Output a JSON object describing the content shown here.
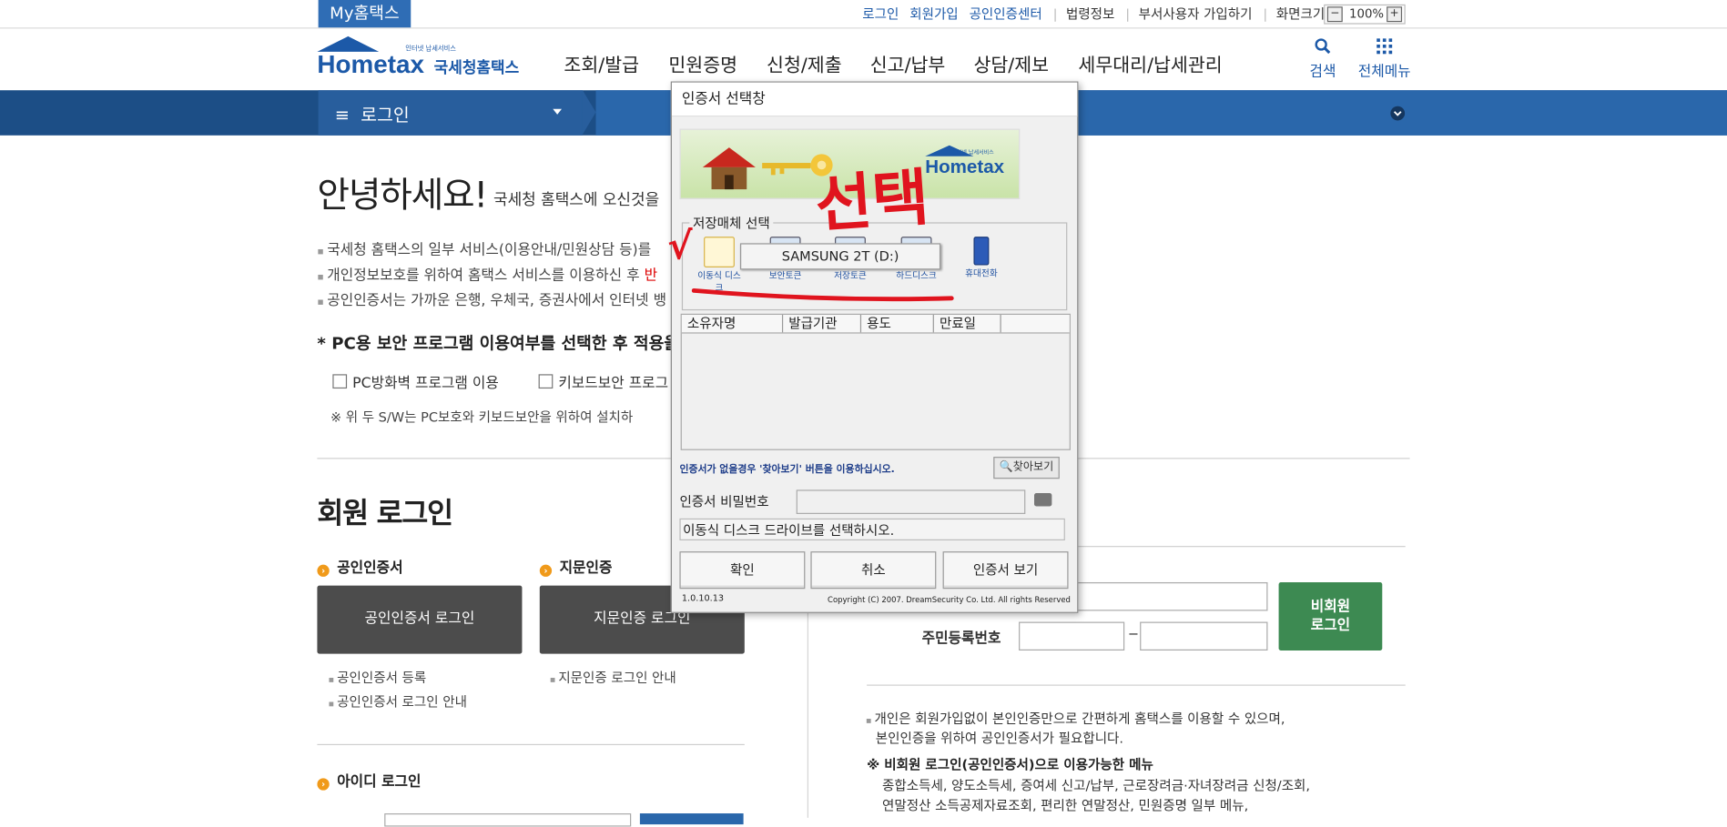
{
  "topbar": {
    "my_hometax": "My홈택스",
    "links": [
      "로그인",
      "회원가입",
      "공인인증센터"
    ],
    "links_gray": [
      "법령정보",
      "부서사용자 가입하기",
      "화면크기"
    ],
    "zoom_minus": "−",
    "zoom_value": "100%",
    "zoom_plus": "+"
  },
  "header": {
    "logo_word": "Hometax",
    "logo_kor": "국세청홈택스",
    "logo_tiny": "인터넷 납세서비스",
    "menu": [
      "조회/발급",
      "민원증명",
      "신청/제출",
      "신고/납부",
      "상담/제보",
      "세무대리/납세관리"
    ],
    "search_icon": "search-icon",
    "search_label": "검색",
    "allmenu_icon": "grid-icon",
    "allmenu_label": "전체메뉴"
  },
  "nav": {
    "current": "로그인"
  },
  "intro": {
    "hello": "안녕하세요!",
    "hello_sub": "국세청 홈택스에 오신것을",
    "bullets": [
      "국세청 홈택스의 일부 서비스(이용안내/민원상담 등)를",
      "개인정보보호를 위하여 홈택스 서비스를 이용하신 후",
      "공인인증서는 가까운 은행, 우체국, 증권사에서 인터넷 뱅"
    ],
    "bullet2_red": "반",
    "pc_title": "* PC용 보안 프로그램 이용여부를 선택한 후 적용을",
    "check1": "PC방화벽 프로그램 이용",
    "check2": "키보드보안 프로그",
    "note": "※ 위 두 S/W는 PC보호와 키보드보안을 위하여 설치하"
  },
  "member": {
    "title": "회원 로그인",
    "cert_title": "공인인증서",
    "cert_btn": "공인인증서 로그인",
    "cert_links": [
      "공인인증서 등록",
      "공인인증서 로그인 안내"
    ],
    "finger_title": "지문인증",
    "finger_btn": "지문인증 로그인",
    "finger_links": [
      "지문인증 로그인 안내"
    ],
    "id_title": "아이디 로그인"
  },
  "nonmember": {
    "rrn_label": "주민등록번호",
    "dash": "−",
    "btn_line1": "비회원",
    "btn_line2": "로그인",
    "info1": "개인은 회원가입없이 본인인증만으로 간편하게 홈택스를 이용할 수 있으며,",
    "info2_red": "본인인증을 위하여 공인인증서가 필요합니다.",
    "menu_title": "※ 비회원 로그인(공인인증서)으로 이용가능한 메뉴",
    "menu_line1": "종합소득세, 양도소득세, 증여세 신고/납부, 근로장려금·자녀장려금 신청/조회,",
    "menu_line2": "연말정산 소득공제자료조회, 편리한 연말정산, 민원증명 일부 메뉴,"
  },
  "dialog": {
    "title": "인증서 선택창",
    "banner_logo": "Hometax",
    "banner_tiny": "인터넷 납세서비스",
    "media_legend": "저장매체 선택",
    "media": [
      "이동식 디스크",
      "보안토큰",
      "저장토큰",
      "하드디스크",
      "휴대전화"
    ],
    "drive_tip": "SAMSUNG 2T (D:)",
    "columns": [
      "소유자명",
      "발급기관",
      "용도",
      "만료일"
    ],
    "hint": "인증서가 없을경우 '찾아보기' 버튼을 이용하십시오.",
    "find_btn": "찾아보기",
    "pw_label": "인증서 비밀번호",
    "status": "이동식 디스크 드라이브를 선택하시오.",
    "btn_ok": "확인",
    "btn_cancel": "취소",
    "btn_view": "인증서 보기",
    "version": "1.0.10.13",
    "copyright": "Copyright (C) 2007. DreamSecurity Co. Ltd. All rights Reserved"
  },
  "annotation": {
    "text": "선택",
    "check": "√",
    "color": "#e0141e"
  },
  "colors": {
    "brand_blue": "#1c59a8",
    "nav_blue": "#1c4e86",
    "green": "#3d8a52",
    "orange": "#f09a1a"
  }
}
